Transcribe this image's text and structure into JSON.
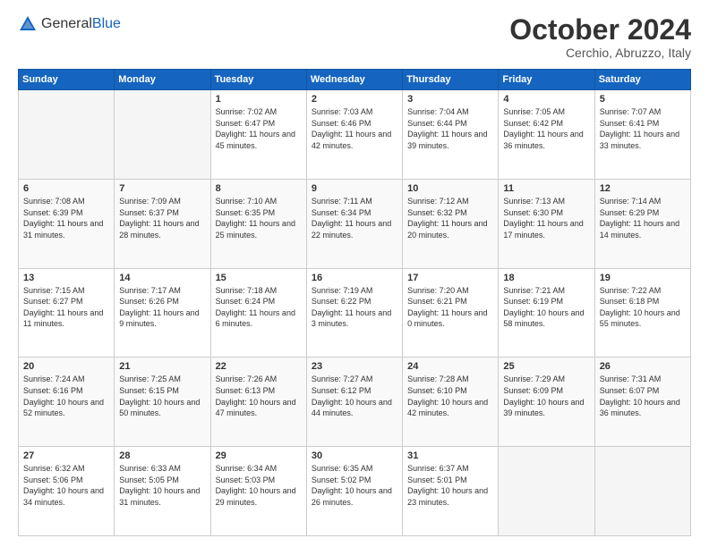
{
  "logo": {
    "general": "General",
    "blue": "Blue"
  },
  "header": {
    "month": "October 2024",
    "location": "Cerchio, Abruzzo, Italy"
  },
  "weekdays": [
    "Sunday",
    "Monday",
    "Tuesday",
    "Wednesday",
    "Thursday",
    "Friday",
    "Saturday"
  ],
  "weeks": [
    [
      {
        "day": "",
        "empty": true
      },
      {
        "day": "",
        "empty": true
      },
      {
        "day": "1",
        "sunrise": "Sunrise: 7:02 AM",
        "sunset": "Sunset: 6:47 PM",
        "daylight": "Daylight: 11 hours and 45 minutes."
      },
      {
        "day": "2",
        "sunrise": "Sunrise: 7:03 AM",
        "sunset": "Sunset: 6:46 PM",
        "daylight": "Daylight: 11 hours and 42 minutes."
      },
      {
        "day": "3",
        "sunrise": "Sunrise: 7:04 AM",
        "sunset": "Sunset: 6:44 PM",
        "daylight": "Daylight: 11 hours and 39 minutes."
      },
      {
        "day": "4",
        "sunrise": "Sunrise: 7:05 AM",
        "sunset": "Sunset: 6:42 PM",
        "daylight": "Daylight: 11 hours and 36 minutes."
      },
      {
        "day": "5",
        "sunrise": "Sunrise: 7:07 AM",
        "sunset": "Sunset: 6:41 PM",
        "daylight": "Daylight: 11 hours and 33 minutes."
      }
    ],
    [
      {
        "day": "6",
        "sunrise": "Sunrise: 7:08 AM",
        "sunset": "Sunset: 6:39 PM",
        "daylight": "Daylight: 11 hours and 31 minutes."
      },
      {
        "day": "7",
        "sunrise": "Sunrise: 7:09 AM",
        "sunset": "Sunset: 6:37 PM",
        "daylight": "Daylight: 11 hours and 28 minutes."
      },
      {
        "day": "8",
        "sunrise": "Sunrise: 7:10 AM",
        "sunset": "Sunset: 6:35 PM",
        "daylight": "Daylight: 11 hours and 25 minutes."
      },
      {
        "day": "9",
        "sunrise": "Sunrise: 7:11 AM",
        "sunset": "Sunset: 6:34 PM",
        "daylight": "Daylight: 11 hours and 22 minutes."
      },
      {
        "day": "10",
        "sunrise": "Sunrise: 7:12 AM",
        "sunset": "Sunset: 6:32 PM",
        "daylight": "Daylight: 11 hours and 20 minutes."
      },
      {
        "day": "11",
        "sunrise": "Sunrise: 7:13 AM",
        "sunset": "Sunset: 6:30 PM",
        "daylight": "Daylight: 11 hours and 17 minutes."
      },
      {
        "day": "12",
        "sunrise": "Sunrise: 7:14 AM",
        "sunset": "Sunset: 6:29 PM",
        "daylight": "Daylight: 11 hours and 14 minutes."
      }
    ],
    [
      {
        "day": "13",
        "sunrise": "Sunrise: 7:15 AM",
        "sunset": "Sunset: 6:27 PM",
        "daylight": "Daylight: 11 hours and 11 minutes."
      },
      {
        "day": "14",
        "sunrise": "Sunrise: 7:17 AM",
        "sunset": "Sunset: 6:26 PM",
        "daylight": "Daylight: 11 hours and 9 minutes."
      },
      {
        "day": "15",
        "sunrise": "Sunrise: 7:18 AM",
        "sunset": "Sunset: 6:24 PM",
        "daylight": "Daylight: 11 hours and 6 minutes."
      },
      {
        "day": "16",
        "sunrise": "Sunrise: 7:19 AM",
        "sunset": "Sunset: 6:22 PM",
        "daylight": "Daylight: 11 hours and 3 minutes."
      },
      {
        "day": "17",
        "sunrise": "Sunrise: 7:20 AM",
        "sunset": "Sunset: 6:21 PM",
        "daylight": "Daylight: 11 hours and 0 minutes."
      },
      {
        "day": "18",
        "sunrise": "Sunrise: 7:21 AM",
        "sunset": "Sunset: 6:19 PM",
        "daylight": "Daylight: 10 hours and 58 minutes."
      },
      {
        "day": "19",
        "sunrise": "Sunrise: 7:22 AM",
        "sunset": "Sunset: 6:18 PM",
        "daylight": "Daylight: 10 hours and 55 minutes."
      }
    ],
    [
      {
        "day": "20",
        "sunrise": "Sunrise: 7:24 AM",
        "sunset": "Sunset: 6:16 PM",
        "daylight": "Daylight: 10 hours and 52 minutes."
      },
      {
        "day": "21",
        "sunrise": "Sunrise: 7:25 AM",
        "sunset": "Sunset: 6:15 PM",
        "daylight": "Daylight: 10 hours and 50 minutes."
      },
      {
        "day": "22",
        "sunrise": "Sunrise: 7:26 AM",
        "sunset": "Sunset: 6:13 PM",
        "daylight": "Daylight: 10 hours and 47 minutes."
      },
      {
        "day": "23",
        "sunrise": "Sunrise: 7:27 AM",
        "sunset": "Sunset: 6:12 PM",
        "daylight": "Daylight: 10 hours and 44 minutes."
      },
      {
        "day": "24",
        "sunrise": "Sunrise: 7:28 AM",
        "sunset": "Sunset: 6:10 PM",
        "daylight": "Daylight: 10 hours and 42 minutes."
      },
      {
        "day": "25",
        "sunrise": "Sunrise: 7:29 AM",
        "sunset": "Sunset: 6:09 PM",
        "daylight": "Daylight: 10 hours and 39 minutes."
      },
      {
        "day": "26",
        "sunrise": "Sunrise: 7:31 AM",
        "sunset": "Sunset: 6:07 PM",
        "daylight": "Daylight: 10 hours and 36 minutes."
      }
    ],
    [
      {
        "day": "27",
        "sunrise": "Sunrise: 6:32 AM",
        "sunset": "Sunset: 5:06 PM",
        "daylight": "Daylight: 10 hours and 34 minutes."
      },
      {
        "day": "28",
        "sunrise": "Sunrise: 6:33 AM",
        "sunset": "Sunset: 5:05 PM",
        "daylight": "Daylight: 10 hours and 31 minutes."
      },
      {
        "day": "29",
        "sunrise": "Sunrise: 6:34 AM",
        "sunset": "Sunset: 5:03 PM",
        "daylight": "Daylight: 10 hours and 29 minutes."
      },
      {
        "day": "30",
        "sunrise": "Sunrise: 6:35 AM",
        "sunset": "Sunset: 5:02 PM",
        "daylight": "Daylight: 10 hours and 26 minutes."
      },
      {
        "day": "31",
        "sunrise": "Sunrise: 6:37 AM",
        "sunset": "Sunset: 5:01 PM",
        "daylight": "Daylight: 10 hours and 23 minutes."
      },
      {
        "day": "",
        "empty": true
      },
      {
        "day": "",
        "empty": true
      }
    ]
  ]
}
